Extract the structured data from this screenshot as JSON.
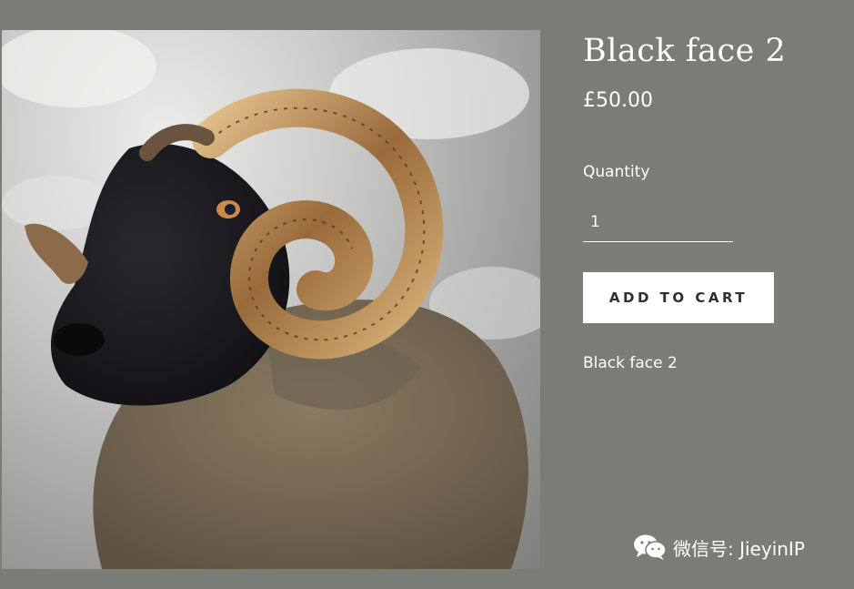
{
  "product": {
    "title": "Black face 2",
    "price": "£50.00",
    "quantity_label": "Quantity",
    "quantity_value": "1",
    "add_to_cart_label": "ADD TO CART",
    "description": "Black face 2",
    "image_subject": "black-faced ram with curled horns"
  },
  "watermark": {
    "icon": "wechat-icon",
    "text": "微信号: JieyinIP"
  },
  "colors": {
    "background": "#7b7c76",
    "button_bg": "#ffffff",
    "button_text": "#2e2e2e",
    "text": "#ffffff"
  }
}
